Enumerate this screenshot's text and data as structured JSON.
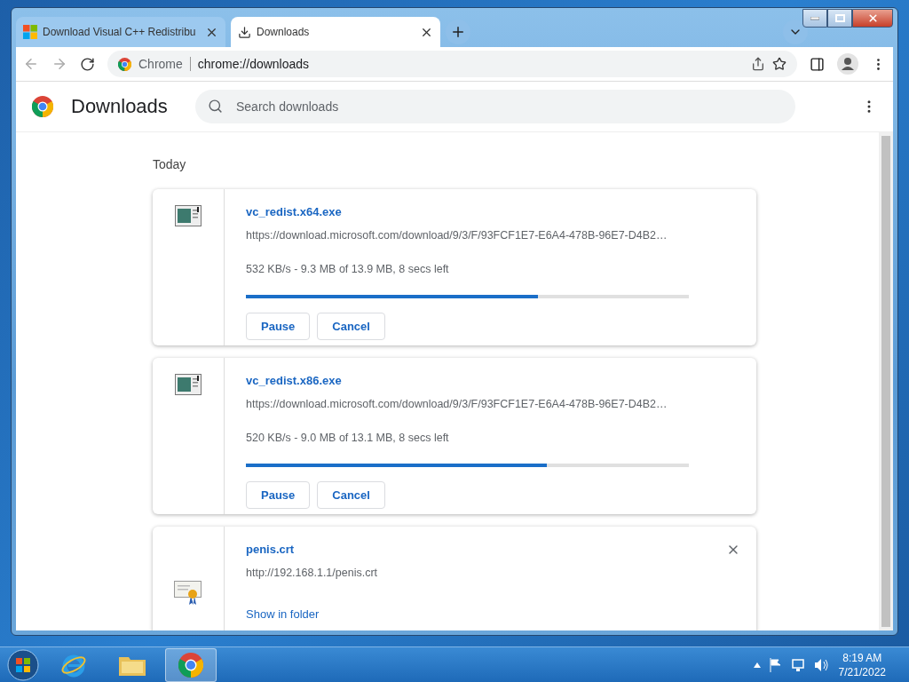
{
  "tabs": [
    {
      "title": "Download Visual C++ Redistribu",
      "selected": false,
      "kind": "site"
    },
    {
      "title": "Downloads",
      "selected": true,
      "kind": "downloads"
    }
  ],
  "toolbar": {
    "site_label": "Chrome",
    "url": "chrome://downloads"
  },
  "page": {
    "title": "Downloads",
    "search": {
      "placeholder": "Search downloads"
    },
    "date_heading": "Today",
    "downloads": [
      {
        "kind": "progress",
        "file_name": "vc_redist.x64.exe",
        "url": "https://download.microsoft.com/download/9/3/F/93FCF1E7-E6A4-478B-96E7-D4B2…",
        "status": "532 KB/s - 9.3 MB of 13.9 MB, 8 secs left",
        "level": 0.66,
        "buttons": [
          "Pause",
          "Cancel"
        ]
      },
      {
        "kind": "progress",
        "file_name": "vc_redist.x86.exe",
        "url": "https://download.microsoft.com/download/9/3/F/93FCF1E7-E6A4-478B-96E7-D4B2…",
        "status": "520 KB/s - 9.0 MB of 13.1 MB, 8 secs left",
        "level": 0.68,
        "buttons": [
          "Pause",
          "Cancel"
        ]
      },
      {
        "kind": "done",
        "file_name": "penis.crt",
        "url": "http://192.168.1.1/penis.crt",
        "link": "Show in folder"
      }
    ]
  },
  "taskbar": {
    "time": "8:19 AM",
    "date": "7/21/2022"
  }
}
